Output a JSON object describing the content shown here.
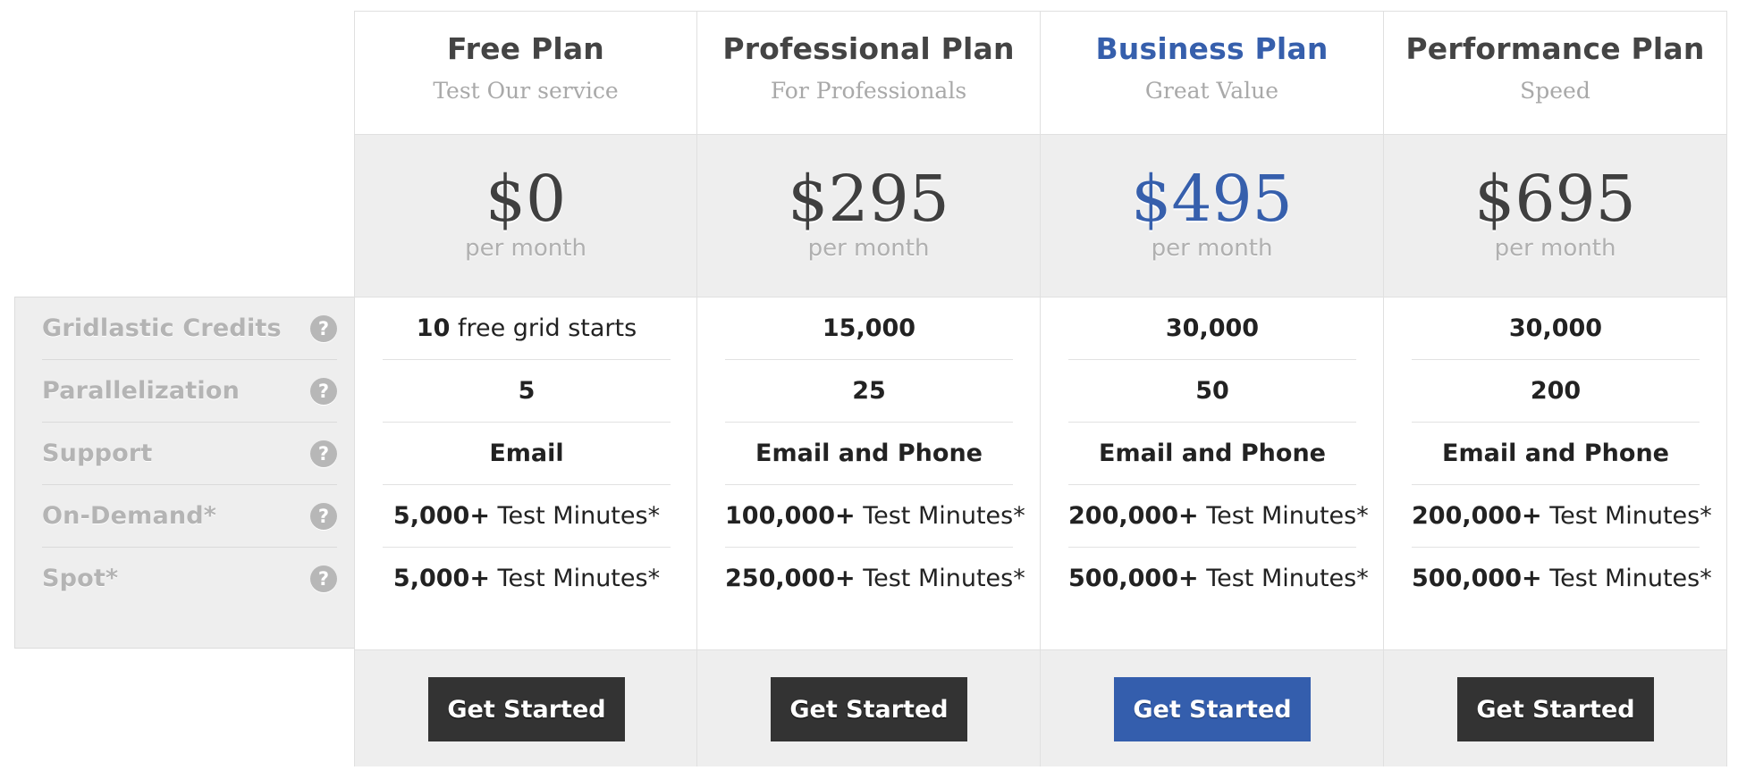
{
  "features": [
    {
      "label": "Gridlastic Credits",
      "icon": "question-circle-icon"
    },
    {
      "label": "Parallelization",
      "icon": "question-circle-icon"
    },
    {
      "label": "Support",
      "icon": "question-circle-icon"
    },
    {
      "label": "On-Demand*",
      "icon": "question-circle-icon"
    },
    {
      "label": "Spot*",
      "icon": "question-circle-icon"
    }
  ],
  "help_glyph": "?",
  "plans": [
    {
      "name": "Free Plan",
      "tagline": "Test Our service",
      "price": "$0",
      "period": "per month",
      "featured": false,
      "values": [
        {
          "bold": "10",
          "rest": " free grid starts"
        },
        {
          "bold": "5",
          "rest": ""
        },
        {
          "bold": "Email",
          "rest": ""
        },
        {
          "bold": "5,000+",
          "rest": " Test Minutes*"
        },
        {
          "bold": "5,000+",
          "rest": " Test Minutes*"
        }
      ],
      "cta": "Get Started"
    },
    {
      "name": "Professional Plan",
      "tagline": "For Professionals",
      "price": "$295",
      "period": "per month",
      "featured": false,
      "values": [
        {
          "bold": "15,000",
          "rest": ""
        },
        {
          "bold": "25",
          "rest": ""
        },
        {
          "bold": "Email and Phone",
          "rest": ""
        },
        {
          "bold": "100,000+",
          "rest": " Test Minutes*"
        },
        {
          "bold": "250,000+",
          "rest": " Test Minutes*"
        }
      ],
      "cta": "Get Started"
    },
    {
      "name": "Business Plan",
      "tagline": "Great Value",
      "price": "$495",
      "period": "per month",
      "featured": true,
      "values": [
        {
          "bold": "30,000",
          "rest": ""
        },
        {
          "bold": "50",
          "rest": ""
        },
        {
          "bold": "Email and Phone",
          "rest": ""
        },
        {
          "bold": "200,000+",
          "rest": " Test Minutes*"
        },
        {
          "bold": "500,000+",
          "rest": " Test Minutes*"
        }
      ],
      "cta": "Get Started"
    },
    {
      "name": "Performance Plan",
      "tagline": "Speed",
      "price": "$695",
      "period": "per month",
      "featured": false,
      "values": [
        {
          "bold": "30,000",
          "rest": ""
        },
        {
          "bold": "200",
          "rest": ""
        },
        {
          "bold": "Email and Phone",
          "rest": ""
        },
        {
          "bold": "200,000+",
          "rest": " Test Minutes*"
        },
        {
          "bold": "500,000+",
          "rest": " Test Minutes*"
        }
      ],
      "cta": "Get Started"
    }
  ],
  "colors": {
    "accent": "#345ead",
    "button_dark": "#333333",
    "panel_gray": "#eeeeee",
    "label_gray": "#b4b4b4"
  }
}
